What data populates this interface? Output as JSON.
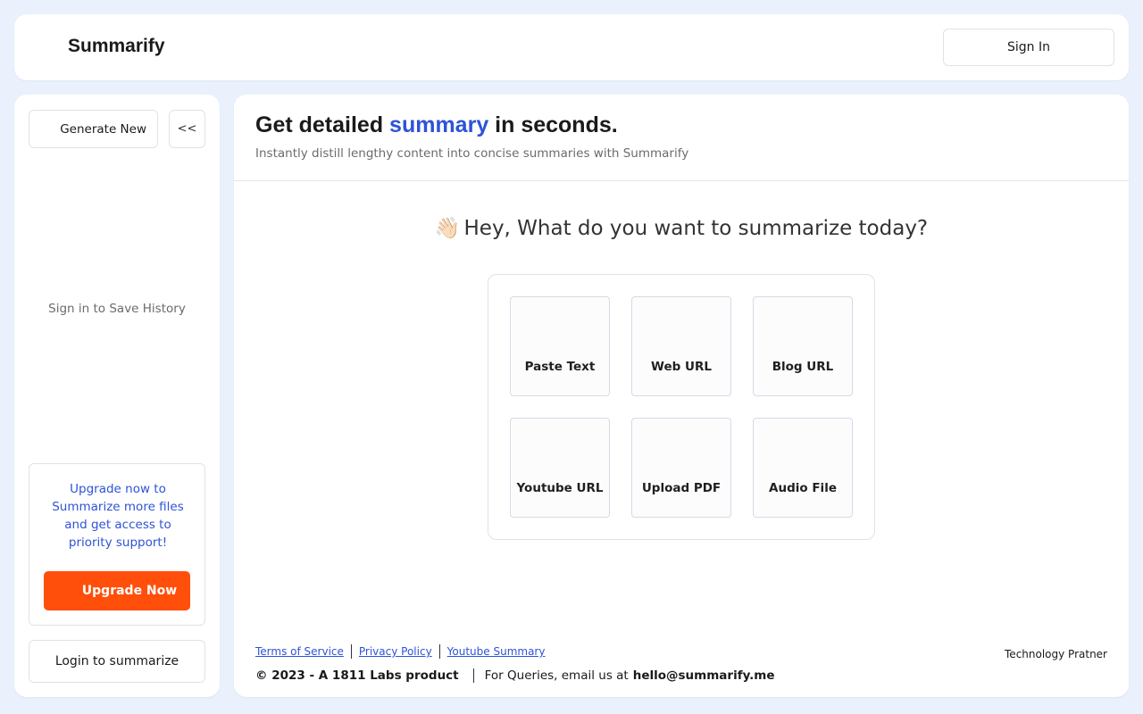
{
  "header": {
    "brand": "Summarify",
    "signin_label": "Sign In"
  },
  "sidebar": {
    "generate_label": "Generate New",
    "collapse_label": "<<",
    "history_note": "Sign in to Save History",
    "upgrade_text": "Upgrade now to Summarize more files and get access to priority support!",
    "upgrade_button": "Upgrade Now",
    "login_label": "Login to summarize"
  },
  "main": {
    "title_prefix": "Get detailed ",
    "title_accent": "summary",
    "title_suffix": " in seconds.",
    "subtitle": "Instantly distill lengthy content into concise summaries with Summarify",
    "greeting_emoji": "👋🏻",
    "greeting": "Hey, What do you want to summarize today?",
    "options": [
      {
        "label": "Paste Text"
      },
      {
        "label": "Web URL"
      },
      {
        "label": "Blog URL"
      },
      {
        "label": "Youtube URL"
      },
      {
        "label": "Upload PDF"
      },
      {
        "label": "Audio File"
      }
    ]
  },
  "footer": {
    "links": [
      "Terms of Service",
      "Privacy Policy",
      "Youtube Summary"
    ],
    "copyright": "© 2023 - A 1811 Labs product",
    "queries": "For Queries, email us at",
    "email": "hello@summarify.me",
    "tech_partner": "Technology Pratner"
  },
  "colors": {
    "accent": "#2e53d6",
    "upgrade_button": "#ff4f0a",
    "background": "#eaf1fc"
  }
}
